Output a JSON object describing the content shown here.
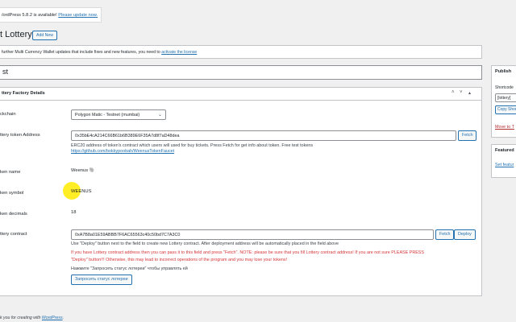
{
  "update_nag": {
    "prefix": "/ordPress 5.8.2",
    "middle": " is available! ",
    "link": "Please update now."
  },
  "page_title": "t Lottery",
  "add_new_label": "Add New",
  "notice": {
    "text": "further Multi Currency Wallet updates that include fixes and new features, you need to ",
    "link": "activate the license"
  },
  "post_title": "st",
  "metabox": {
    "title": "ttery Factory Details",
    "controls": [
      "˄",
      "˅",
      "▴"
    ]
  },
  "rows": {
    "blockchain": {
      "label": "ckchain",
      "value": "Polygon Matic - Testnet (mumbai)"
    },
    "token_address": {
      "label": "ttery token Address",
      "value": "0x35bE4cA214C66B61b6B389E6F35A7d8f7aD48dea",
      "fetch_label": "Fetch",
      "desc1": "ERC20 address of token's contract which users will used for buy tickets. Press Fetch for get info about token. Free test tokens",
      "desc2": "https://github.com/bokkypoobah/WeenusTokenFaucet"
    },
    "token_name": {
      "label": "ken name",
      "value": "Weenus 🐘"
    },
    "token_symbol": {
      "label": "ken symbol",
      "value": "WEENUS"
    },
    "token_decimals": {
      "label": "ken decimals",
      "value": "18"
    },
    "contract": {
      "label": "ttery contract",
      "value": "0xA7B8a01E59ABBB7F6AC65563c40c50bd7C7A3C0",
      "fetch_label": "Fetch",
      "deploy_label": "Deploy",
      "desc1": "Use \"Deploy\" button next to the field to create new Lottery contract. After deployment address will be automatically placed in the field above",
      "warn1": "If you have Lottery contract address then you can pass it to this field and press \"Fetch\". NOTE: please be sure that you fill Lottery contract address! If you are not sure PLEASE PRESS",
      "warn2": "\"Deploy\" button!!! Otherwise, this may lead to incorrect operations of the program and you may lose your tokens!",
      "ru_hint": "Нажмите \"Запросить статус лотереи\" чтобы управлять ей",
      "status_button": "Запросить статус лотереи"
    }
  },
  "sidebar": {
    "publish_title": "Publish",
    "shortcode_label": "Shortcode",
    "shortcode_value": "[lottery]",
    "copy_label": "Copy Shor",
    "trash_link": "Move to T",
    "featured_title": "Featured",
    "featured_link": "Set featur"
  },
  "footer": {
    "prefix": "k you for creating with ",
    "link": "WordPress",
    "suffix": "."
  }
}
